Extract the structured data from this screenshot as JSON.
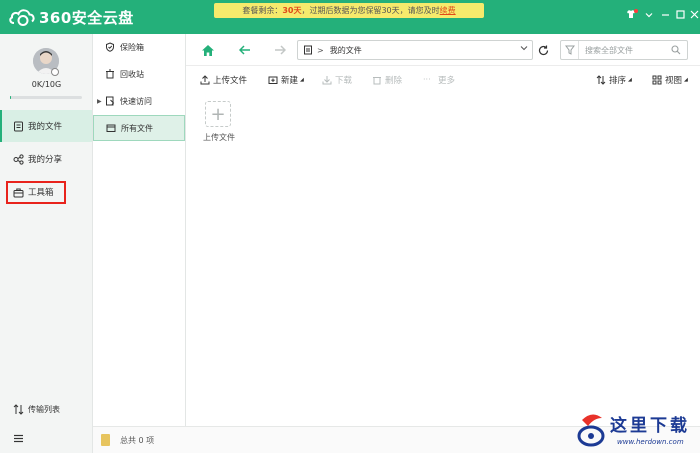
{
  "app": {
    "title": "360安全云盘",
    "banner": {
      "prefix": "套餐剩余：",
      "days": "30天",
      "middle": "，过期后数据为您保留30天，请您及时",
      "renew": "续费"
    }
  },
  "user": {
    "quota": "0K/10G",
    "quota_used_fraction": 0.0
  },
  "leftnav": {
    "items": [
      {
        "label": "我的文件",
        "icon": "file-icon",
        "active": true
      },
      {
        "label": "我的分享",
        "icon": "share-icon",
        "active": false
      },
      {
        "label": "工具箱",
        "icon": "toolbox-icon",
        "active": false
      }
    ],
    "transfer_label": "传输列表",
    "menu_icon": "menu-icon"
  },
  "tree": {
    "items": [
      {
        "label": "保险箱",
        "icon": "shield-icon"
      },
      {
        "label": "回收站",
        "icon": "trash-icon"
      },
      {
        "label": "快速访问",
        "icon": "quick-access-icon"
      },
      {
        "label": "所有文件",
        "icon": "folder-icon",
        "active": true
      }
    ]
  },
  "navbar": {
    "path_label": "我的文件",
    "search_placeholder": "搜索全部文件"
  },
  "toolbar": {
    "upload": "上传文件",
    "new": "新建",
    "download": "下载",
    "delete": "删除",
    "more": "更多",
    "sort": "排序",
    "view": "视图"
  },
  "content": {
    "upload_tile_label": "上传文件"
  },
  "status": {
    "text": "总共 0 项"
  },
  "watermark": {
    "text": "这里下载",
    "url": "www.herdown.com"
  },
  "colors": {
    "brand": "#24b07a",
    "banner_bg": "#f6ea6c",
    "highlight": "#e04a1a",
    "annotation": "#e8231c"
  }
}
